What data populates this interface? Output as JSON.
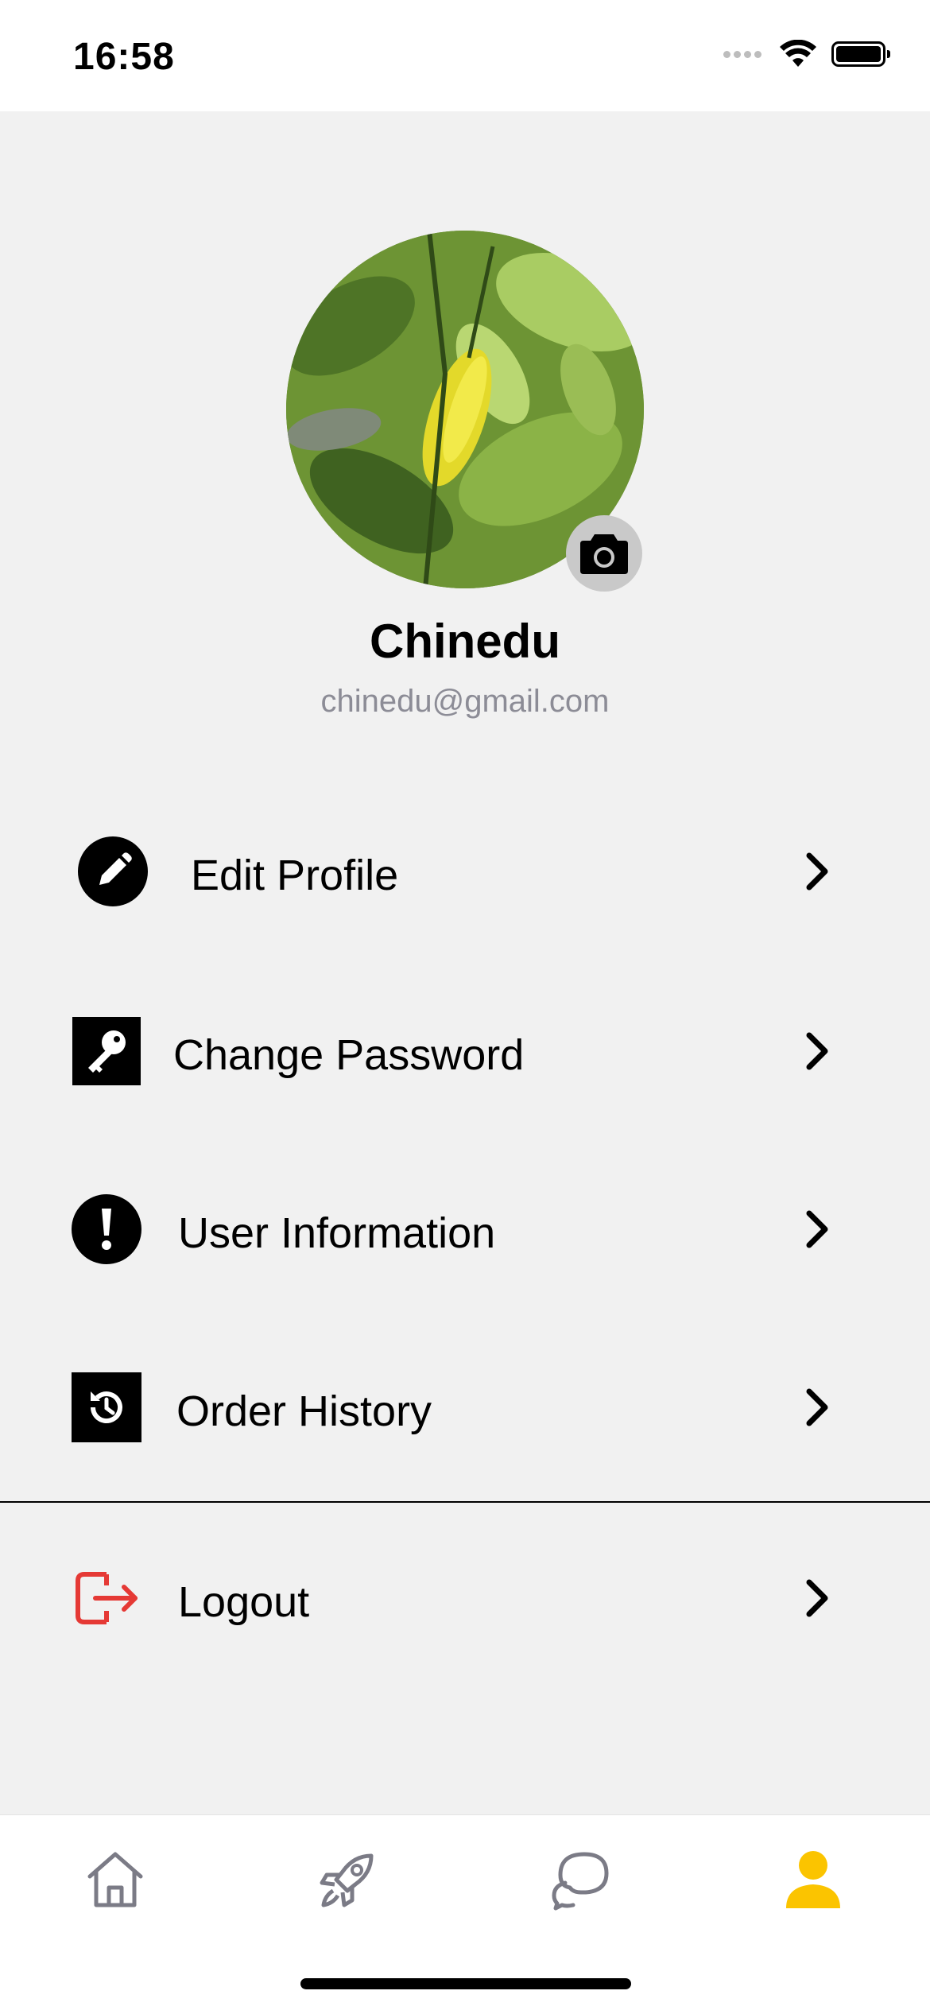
{
  "status_bar": {
    "time": "16:58"
  },
  "profile": {
    "name": "Chinedu",
    "email": "chinedu@gmail.com"
  },
  "menu": {
    "items": [
      {
        "label": "Edit Profile",
        "icon": "pencil-icon"
      },
      {
        "label": "Change Password",
        "icon": "key-icon"
      },
      {
        "label": "User Information",
        "icon": "exclamation-icon"
      },
      {
        "label": "Order History",
        "icon": "history-icon"
      },
      {
        "label": "Logout",
        "icon": "logout-icon"
      }
    ]
  },
  "tab_bar": {
    "tabs": [
      {
        "icon": "home-icon",
        "active": false
      },
      {
        "icon": "rocket-icon",
        "active": false
      },
      {
        "icon": "chat-icon",
        "active": false
      },
      {
        "icon": "user-icon",
        "active": true
      }
    ]
  },
  "colors": {
    "accent": "#fbc400",
    "logout": "#e53935",
    "inactive_tab": "#7b7b86",
    "email": "#8c8c96",
    "background": "#f1f1f1"
  }
}
